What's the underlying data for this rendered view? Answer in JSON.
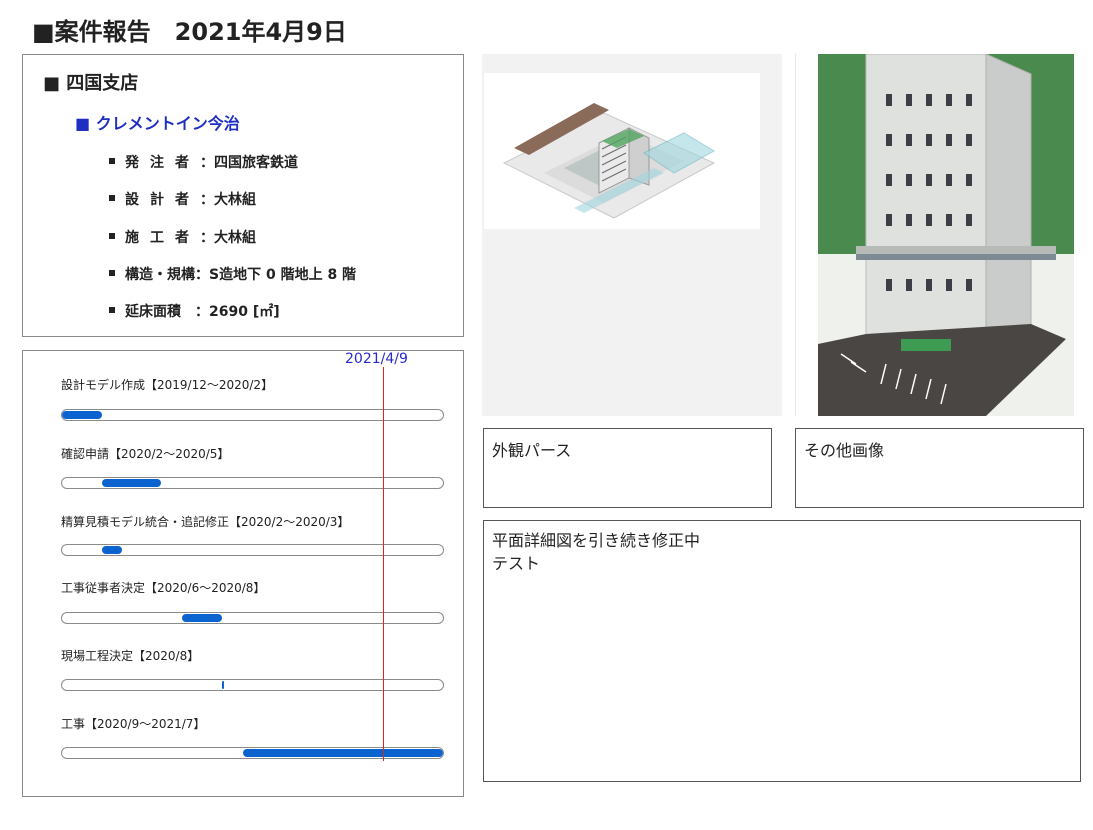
{
  "header": {
    "title": "■案件報告　2021年4月9日"
  },
  "info": {
    "branch": "■ 四国支店",
    "project": "■ クレメントイン今治",
    "details": [
      {
        "label": "発注者",
        "sep": "：",
        "value": "四国旅客鉄道"
      },
      {
        "label": "設計者",
        "sep": "：",
        "value": "大林組"
      },
      {
        "label": "施工者",
        "sep": "：",
        "value": "大林組"
      },
      {
        "label": "構造・規構",
        "sep": "：",
        "value": "S造地下 0 階地上 8 階"
      },
      {
        "label": "延床面積",
        "sep": "　：",
        "value": "2690 [㎡]"
      }
    ]
  },
  "schedule": {
    "today_label": "2021/4/9",
    "today_fraction": 0.84,
    "tasks": [
      {
        "label": "設計モデル作成【2019/12～2020/2】",
        "start": 0.0,
        "end": 0.105
      },
      {
        "label": "確認申請【2020/2～2020/5】",
        "start": 0.105,
        "end": 0.26
      },
      {
        "label": "精算見積モデル統合・追記修正【2020/2～2020/3】",
        "start": 0.105,
        "end": 0.158
      },
      {
        "label": "工事従事者決定【2020/6～2020/8】",
        "start": 0.316,
        "end": 0.42
      },
      {
        "label": "現場工程決定【2020/8】",
        "start": 0.42,
        "end": 0.426
      },
      {
        "label": "工事【2020/9～2021/7】",
        "start": 0.474,
        "end": 1.0
      }
    ],
    "colors": {
      "bar": "#0b63d0",
      "today": "#e2231a",
      "today_label": "#2a2ad2"
    }
  },
  "captions": {
    "exterior": "外観パース",
    "other": "その他画像"
  },
  "memo": {
    "lines": [
      "平面詳細図を引き続き修正中",
      "テスト"
    ]
  }
}
